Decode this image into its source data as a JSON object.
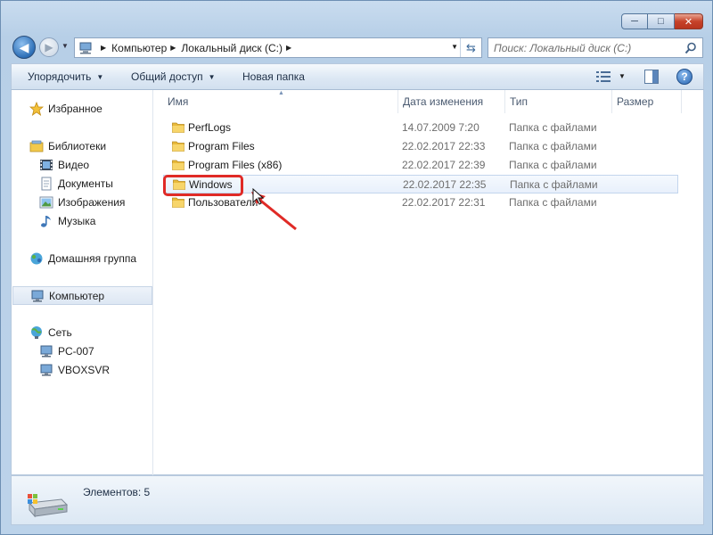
{
  "window": {
    "minimize_glyph": "─",
    "maximize_glyph": "□",
    "close_glyph": "✕"
  },
  "navigation": {
    "back_glyph": "◀",
    "forward_glyph": "▶",
    "dropdown_glyph": "▼",
    "breadcrumbs": [
      {
        "label": "Компьютер"
      },
      {
        "label": "Локальный диск (C:)"
      }
    ],
    "breadcrumb_sep": "▶",
    "refresh_glyph": "⇆",
    "search_placeholder": "Поиск: Локальный диск (C:)"
  },
  "command_bar": {
    "organize": "Упорядочить",
    "share": "Общий доступ",
    "new_folder": "Новая папка",
    "dropdown_glyph": "▼",
    "help_glyph": "?"
  },
  "nav_pane": {
    "favorites": "Избранное",
    "libraries": "Библиотеки",
    "library_items": [
      "Видео",
      "Документы",
      "Изображения",
      "Музыка"
    ],
    "homegroup": "Домашняя группа",
    "computer": "Компьютер",
    "network": "Сеть",
    "network_items": [
      "PC-007",
      "VBOXSVR"
    ]
  },
  "columns": {
    "name": "Имя",
    "date": "Дата изменения",
    "type": "Тип",
    "size": "Размер",
    "sort_glyph": "▲"
  },
  "files": [
    {
      "name": "PerfLogs",
      "date": "14.07.2009 7:20",
      "type": "Папка с файлами",
      "selected": false
    },
    {
      "name": "Program Files",
      "date": "22.02.2017 22:33",
      "type": "Папка с файлами",
      "selected": false
    },
    {
      "name": "Program Files (x86)",
      "date": "22.02.2017 22:39",
      "type": "Папка с файлами",
      "selected": false
    },
    {
      "name": "Windows",
      "date": "22.02.2017 22:35",
      "type": "Папка с файлами",
      "selected": true
    },
    {
      "name": "Пользователи",
      "date": "22.02.2017 22:31",
      "type": "Папка с файлами",
      "selected": false
    }
  ],
  "status": {
    "items_count": "Элементов: 5"
  },
  "colors": {
    "highlight": "#e02a26",
    "folder": "#f2c94c",
    "accent": "#2d6fb7"
  }
}
